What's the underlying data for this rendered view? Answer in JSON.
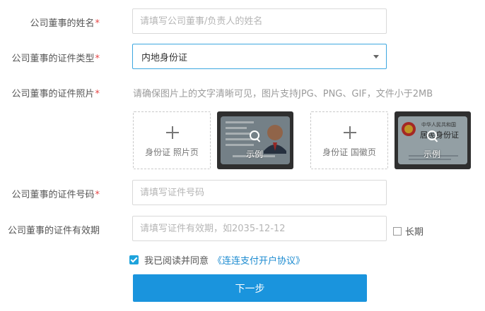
{
  "form": {
    "name": {
      "label": "公司董事的姓名",
      "required": "*",
      "placeholder": "请填写公司董事/负责人的姓名"
    },
    "id_type": {
      "label": "公司董事的证件类型",
      "required": "*",
      "value": "内地身份证"
    },
    "id_photo": {
      "label": "公司董事的证件照片",
      "required": "*",
      "hint": "请确保图片上的文字清晰可见，图片支持JPG、PNG、GIF，文件小于2MB",
      "front_upload_label": "身份证 照片页",
      "back_upload_label": "身份证 国徽页",
      "sample_label": "示例",
      "sample_back_title": "中华人民共和国",
      "sample_back_subtitle": "居民身份证"
    },
    "id_number": {
      "label": "公司董事的证件号码",
      "required": "*",
      "placeholder": "请填写证件号码"
    },
    "id_expiry": {
      "label": "公司董事的证件有效期",
      "placeholder": "请填写证件有效期，如2035-12-12",
      "long_term_label": "长期"
    },
    "agreement": {
      "prefix": "我已阅读并同意",
      "link": "《连连支付开户协议》"
    },
    "submit_label": "下一步"
  },
  "colors": {
    "accent": "#1a94dd",
    "required": "#e64545",
    "link": "#1a8ad0",
    "focus_border": "#3da7e0"
  }
}
